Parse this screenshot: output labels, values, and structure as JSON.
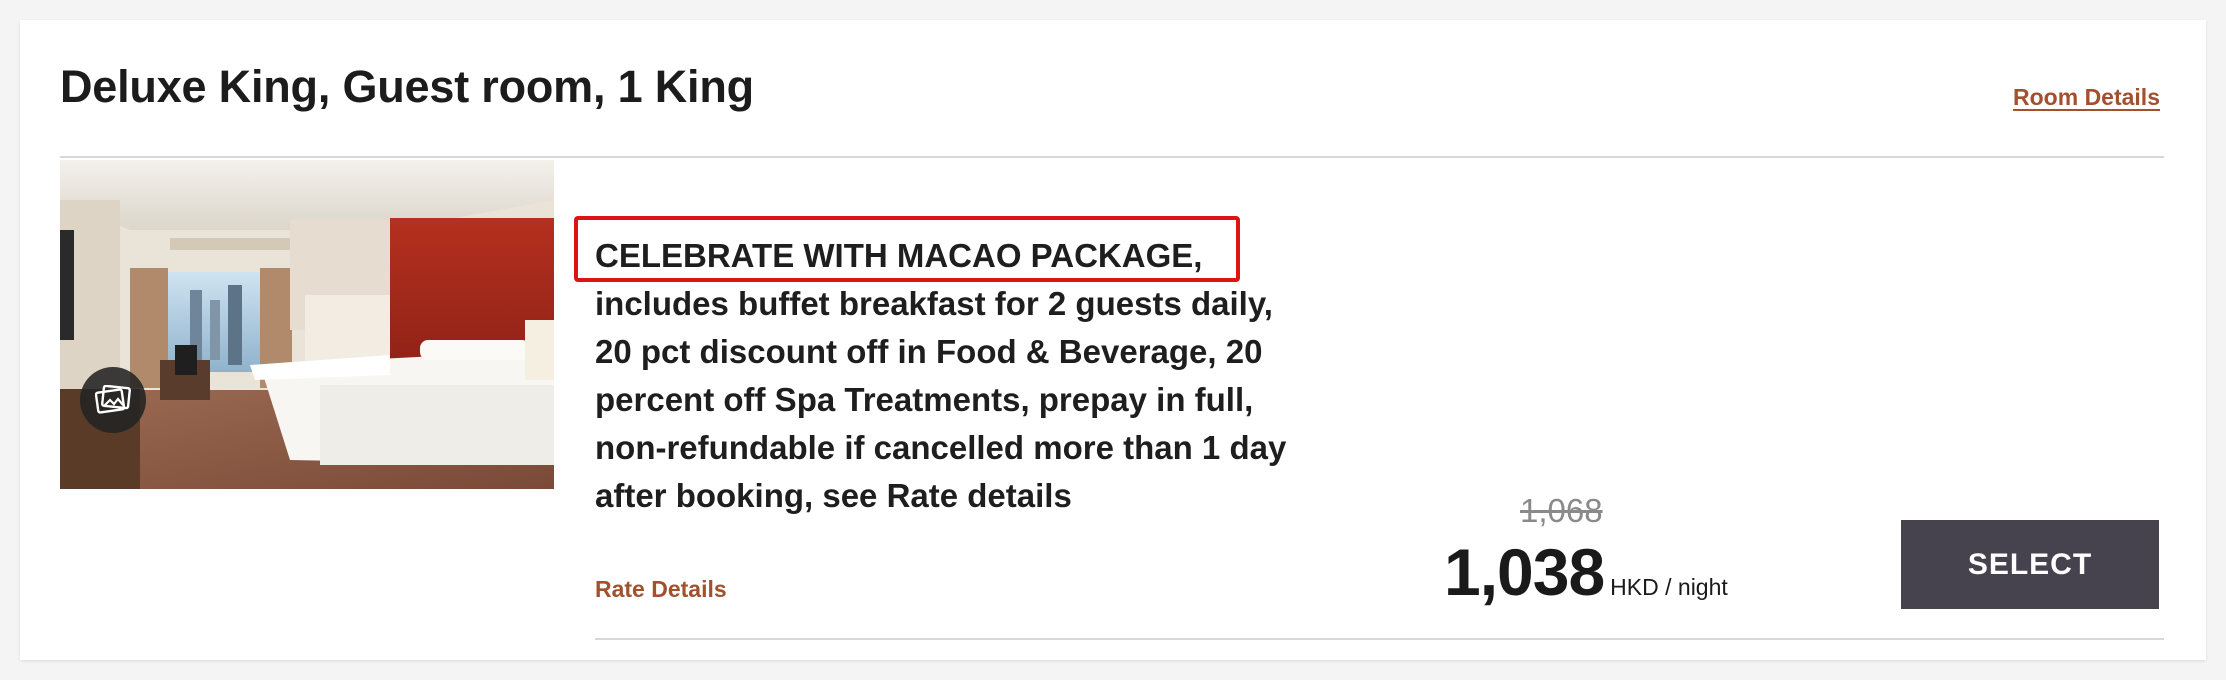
{
  "room": {
    "title": "Deluxe King, Guest room, 1 King",
    "details_link": "Room Details",
    "photo_alt": "room-photo",
    "gallery_icon": "image-gallery-icon"
  },
  "rate": {
    "package_name": "CELEBRATE WITH MACAO PACKAGE,",
    "description": "includes buffet breakfast for 2 guests daily, 20 pct discount off in Food & Beverage, 20 percent off Spa Treatments, prepay in full, non-refundable if cancelled more than 1 day after booking, see Rate details",
    "details_link": "Rate Details"
  },
  "price": {
    "original": "1,068",
    "current": "1,038",
    "unit": "HKD / night"
  },
  "actions": {
    "select_label": "SELECT"
  },
  "colors": {
    "accent_link": "#a1512e",
    "highlight_border": "#dd1414",
    "select_button_bg": "#46434f"
  }
}
